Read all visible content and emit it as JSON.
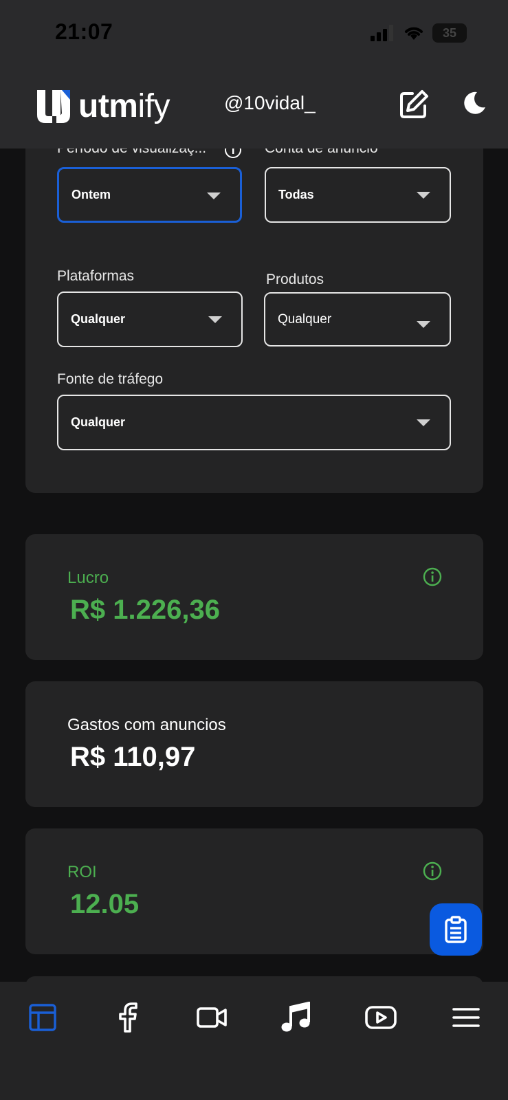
{
  "status_bar": {
    "time": "21:07",
    "battery": "35"
  },
  "header": {
    "logo_bold": "utm",
    "logo_light": "ify",
    "username": "@10vidal_"
  },
  "filters": {
    "period": {
      "label": "Período de visualizaç...",
      "value": "Ontem"
    },
    "ad_account": {
      "label": "Conta de anuncio",
      "value": "Todas"
    },
    "platforms": {
      "label": "Plataformas",
      "value": "Qualquer"
    },
    "products": {
      "label": "Produtos",
      "value": "Qualquer"
    },
    "traffic_source": {
      "label": "Fonte de tráfego",
      "value": "Qualquer"
    }
  },
  "metrics": [
    {
      "label": "Lucro",
      "value": "R$ 1.226,36"
    },
    {
      "label": "Gastos com anuncios",
      "value": "R$ 110,97"
    },
    {
      "label": "ROI",
      "value": "12.05"
    }
  ],
  "colors": {
    "accent": "#1a5fd6",
    "positive": "#4caf50",
    "fab": "#0a5ae0"
  },
  "bottom_nav": [
    {
      "icon": "dashboard-icon",
      "active": true
    },
    {
      "icon": "facebook-icon",
      "active": false
    },
    {
      "icon": "video-camera-icon",
      "active": false
    },
    {
      "icon": "music-note-icon",
      "active": false
    },
    {
      "icon": "youtube-icon",
      "active": false
    },
    {
      "icon": "hamburger-menu-icon",
      "active": false
    }
  ]
}
